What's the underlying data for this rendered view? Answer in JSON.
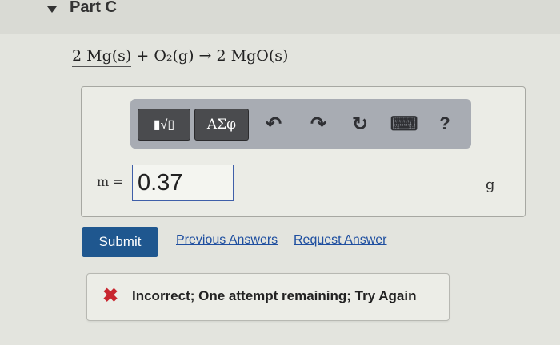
{
  "part": {
    "title": "Part C"
  },
  "equation": {
    "reactant1": "2 Mg(s)",
    "plus": " + ",
    "reactant2": "O₂(g)",
    "arrow": " → ",
    "product": "2 MgO(s)"
  },
  "toolbar": {
    "template_label": "▮√▯",
    "symbols_label": "ΑΣφ",
    "undo_icon": "↶",
    "redo_icon": "↷",
    "reset_icon": "↻",
    "keyboard_icon": "⌨",
    "help_label": "?"
  },
  "answer": {
    "variable_label": "m =",
    "value": "0.37",
    "unit": "g"
  },
  "actions": {
    "submit_label": "Submit",
    "previous_answers_label": "Previous Answers",
    "request_answer_label": "Request Answer"
  },
  "feedback": {
    "icon": "✖",
    "message": "Incorrect; One attempt remaining; Try Again"
  },
  "colors": {
    "submit_bg": "#1f578f",
    "link": "#1f4fa0",
    "error_icon": "#c8262f",
    "toolbar_bg": "#a8acb3"
  }
}
